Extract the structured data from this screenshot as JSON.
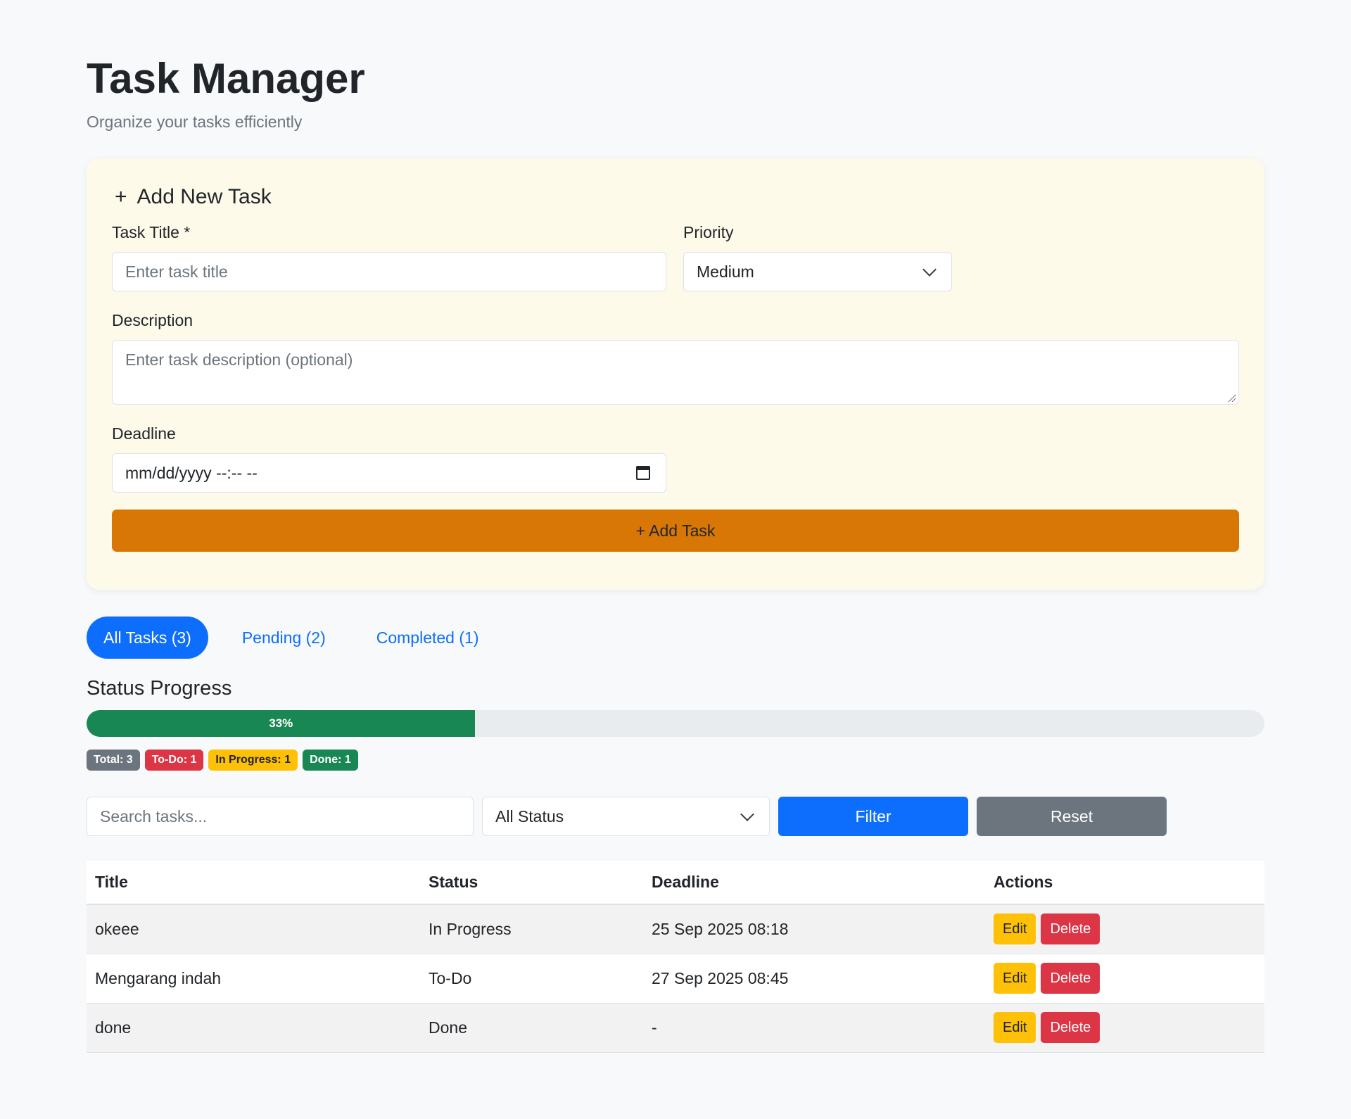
{
  "header": {
    "title": "Task Manager",
    "subtitle": "Organize your tasks efficiently"
  },
  "add_form": {
    "title": "Add New Task",
    "plus_icon": "+",
    "title_label": "Task Title *",
    "title_placeholder": "Enter task title",
    "priority_label": "Priority",
    "priority_value": "Medium",
    "description_label": "Description",
    "description_placeholder": "Enter task description (optional)",
    "deadline_label": "Deadline",
    "deadline_value": "mm/dd/yyyy --:-- --",
    "submit_label": "+ Add Task"
  },
  "tabs": [
    {
      "label": "All Tasks (3)",
      "active": true
    },
    {
      "label": "Pending (2)",
      "active": false
    },
    {
      "label": "Completed (1)",
      "active": false
    }
  ],
  "progress": {
    "title": "Status Progress",
    "percent": 33,
    "label": "33%",
    "badges": [
      {
        "label": "Total: 3",
        "color": "#6c757d",
        "text_color": "#ffffff"
      },
      {
        "label": "To-Do: 1",
        "color": "#dc3545",
        "text_color": "#ffffff"
      },
      {
        "label": "In Progress: 1",
        "color": "#ffc107",
        "text_color": "#212529"
      },
      {
        "label": "Done: 1",
        "color": "#198754",
        "text_color": "#ffffff"
      }
    ]
  },
  "filter": {
    "search_placeholder": "Search tasks...",
    "status_value": "All Status",
    "filter_label": "Filter",
    "reset_label": "Reset"
  },
  "table": {
    "headers": [
      "Title",
      "Status",
      "Deadline",
      "Actions"
    ],
    "rows": [
      {
        "title": "okeee",
        "status": "In Progress",
        "deadline": "25 Sep 2025 08:18"
      },
      {
        "title": "Mengarang indah",
        "status": "To-Do",
        "deadline": "27 Sep 2025 08:45"
      },
      {
        "title": "done",
        "status": "Done",
        "deadline": "-"
      }
    ],
    "edit_label": "Edit",
    "delete_label": "Delete"
  },
  "colors": {
    "primary": "#0d6efd",
    "warning": "#ffc107",
    "danger": "#dc3545",
    "success": "#198754",
    "secondary": "#6c757d",
    "add_button": "#d97706"
  }
}
